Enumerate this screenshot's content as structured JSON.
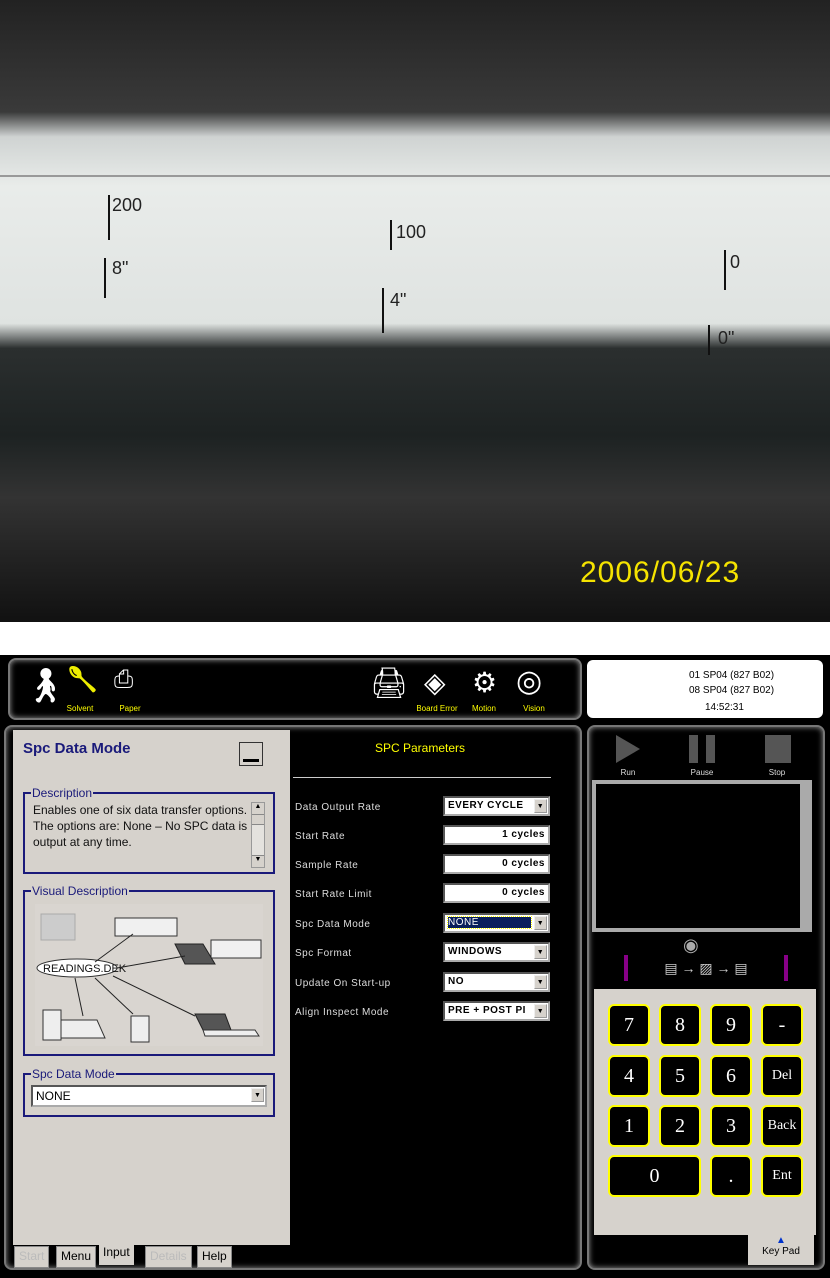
{
  "photo": {
    "date_stamp": "2006/06/23",
    "ruler_marks": [
      "200",
      "100",
      "0",
      "8\"",
      "4\"",
      "0\""
    ]
  },
  "toolbar": {
    "items": [
      {
        "label": "",
        "icon": "operator-icon"
      },
      {
        "label": "Solvent",
        "icon": "solvent-icon"
      },
      {
        "label": "Paper",
        "icon": "paper-icon"
      },
      {
        "label": "",
        "icon": "machine-icon"
      },
      {
        "label": "Board Error",
        "icon": "board-error-icon"
      },
      {
        "label": "Motion",
        "icon": "motion-icon"
      },
      {
        "label": "Vision",
        "icon": "vision-icon"
      }
    ]
  },
  "status": {
    "line1": "01 SP04 (827 B02)",
    "line2": "08 SP04 (827 B02)",
    "time": "14:52:31"
  },
  "left_panel": {
    "title": "Spc Data Mode",
    "description_legend": "Description",
    "description": "Enables one of six data transfer options. The options are: None – No SPC data is output at any time.",
    "visual_legend": "Visual Description",
    "visual_file_label": "READINGS.DEK",
    "mode_legend": "Spc Data Mode",
    "mode_value": "NONE"
  },
  "params": {
    "title": "SPC Parameters",
    "rows": [
      {
        "label": "Data Output Rate",
        "value": "EVERY CYCLE",
        "type": "dropdown"
      },
      {
        "label": "Start Rate",
        "value": "1 cycles",
        "type": "number"
      },
      {
        "label": "Sample Rate",
        "value": "0 cycles",
        "type": "number"
      },
      {
        "label": "Start Rate Limit",
        "value": "0 cycles",
        "type": "number"
      },
      {
        "label": "Spc Data Mode",
        "value": "NONE",
        "type": "dropdown",
        "selected": true
      },
      {
        "label": "Spc Format",
        "value": "WINDOWS",
        "type": "dropdown"
      },
      {
        "label": "Update On Start-up",
        "value": "NO",
        "type": "dropdown"
      },
      {
        "label": "Align Inspect Mode",
        "value": "PRE + POST PI",
        "type": "dropdown"
      }
    ]
  },
  "controls": {
    "run": "Run",
    "pause": "Pause",
    "stop": "Stop"
  },
  "keypad": {
    "keys": [
      "7",
      "8",
      "9",
      "-",
      "4",
      "5",
      "6",
      "Del",
      "1",
      "2",
      "3",
      "Back",
      "0",
      ".",
      "Ent"
    ],
    "tab_label": "Key Pad"
  },
  "tabs": [
    {
      "label": "Start",
      "enabled": false
    },
    {
      "label": "Menu",
      "enabled": true
    },
    {
      "label": "Input",
      "enabled": true,
      "active": true
    },
    {
      "label": "Details",
      "enabled": false
    },
    {
      "label": "Help",
      "enabled": true
    }
  ],
  "colors": {
    "accent_yellow": "#ffff00",
    "title_blue": "#1a1a7a",
    "panel_gray": "#d6d2cc"
  }
}
